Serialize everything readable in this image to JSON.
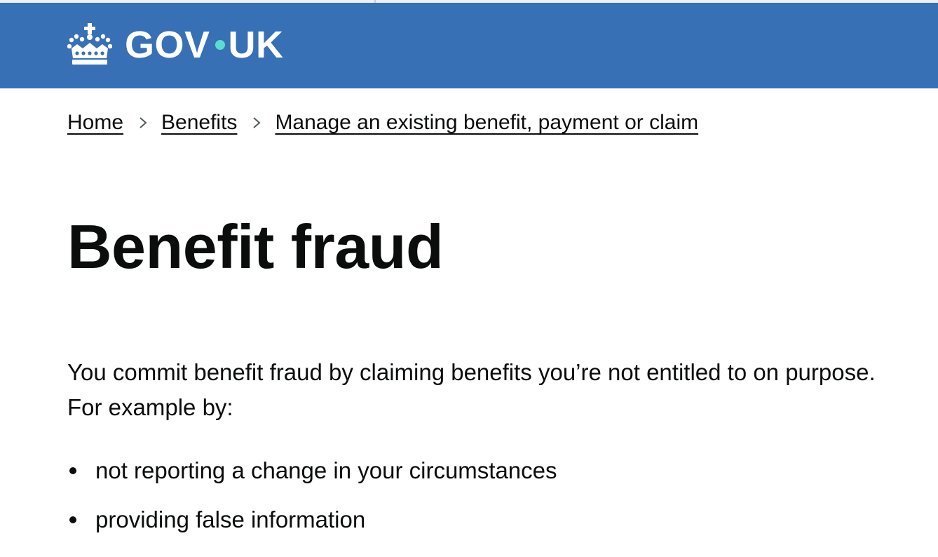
{
  "header": {
    "logo_text_left": "GOV",
    "logo_text_right": "UK",
    "logo_icon": "crown-icon",
    "background_color": "#3870b5",
    "dot_color": "#5bdcd0"
  },
  "breadcrumbs": [
    {
      "label": "Home"
    },
    {
      "label": "Benefits"
    },
    {
      "label": "Manage an existing benefit, payment or claim"
    }
  ],
  "main": {
    "title": "Benefit fraud",
    "intro": "You commit benefit fraud by claiming benefits you’re not entitled to on purpose. For example by:",
    "bullets": [
      "not reporting a change in your circumstances",
      "providing false information"
    ]
  }
}
